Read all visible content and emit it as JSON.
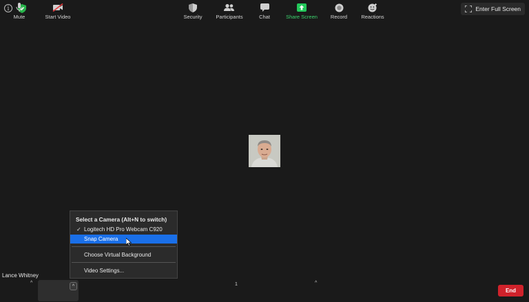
{
  "topbar": {
    "fullscreen_label": "Enter Full Screen"
  },
  "camera_menu": {
    "title": "Select a Camera (Alt+N to switch)",
    "items": [
      {
        "label": "Logitech HD Pro Webcam C920",
        "checked": true
      },
      {
        "label": "Snap Camera",
        "highlighted": true
      }
    ],
    "virtual_background": "Choose Virtual Background",
    "video_settings": "Video Settings..."
  },
  "participant": {
    "name": "Lance Whitney"
  },
  "toolbar": {
    "mute": "Mute",
    "start_video": "Start Video",
    "security": "Security",
    "participants": "Participants",
    "participants_count": "1",
    "chat": "Chat",
    "share_screen": "Share Screen",
    "record": "Record",
    "reactions": "Reactions",
    "end": "End"
  },
  "colors": {
    "background": "#1a1a1a",
    "accent": "#1a6fe8",
    "share_green": "#23c85a",
    "end_red": "#d0222b"
  }
}
